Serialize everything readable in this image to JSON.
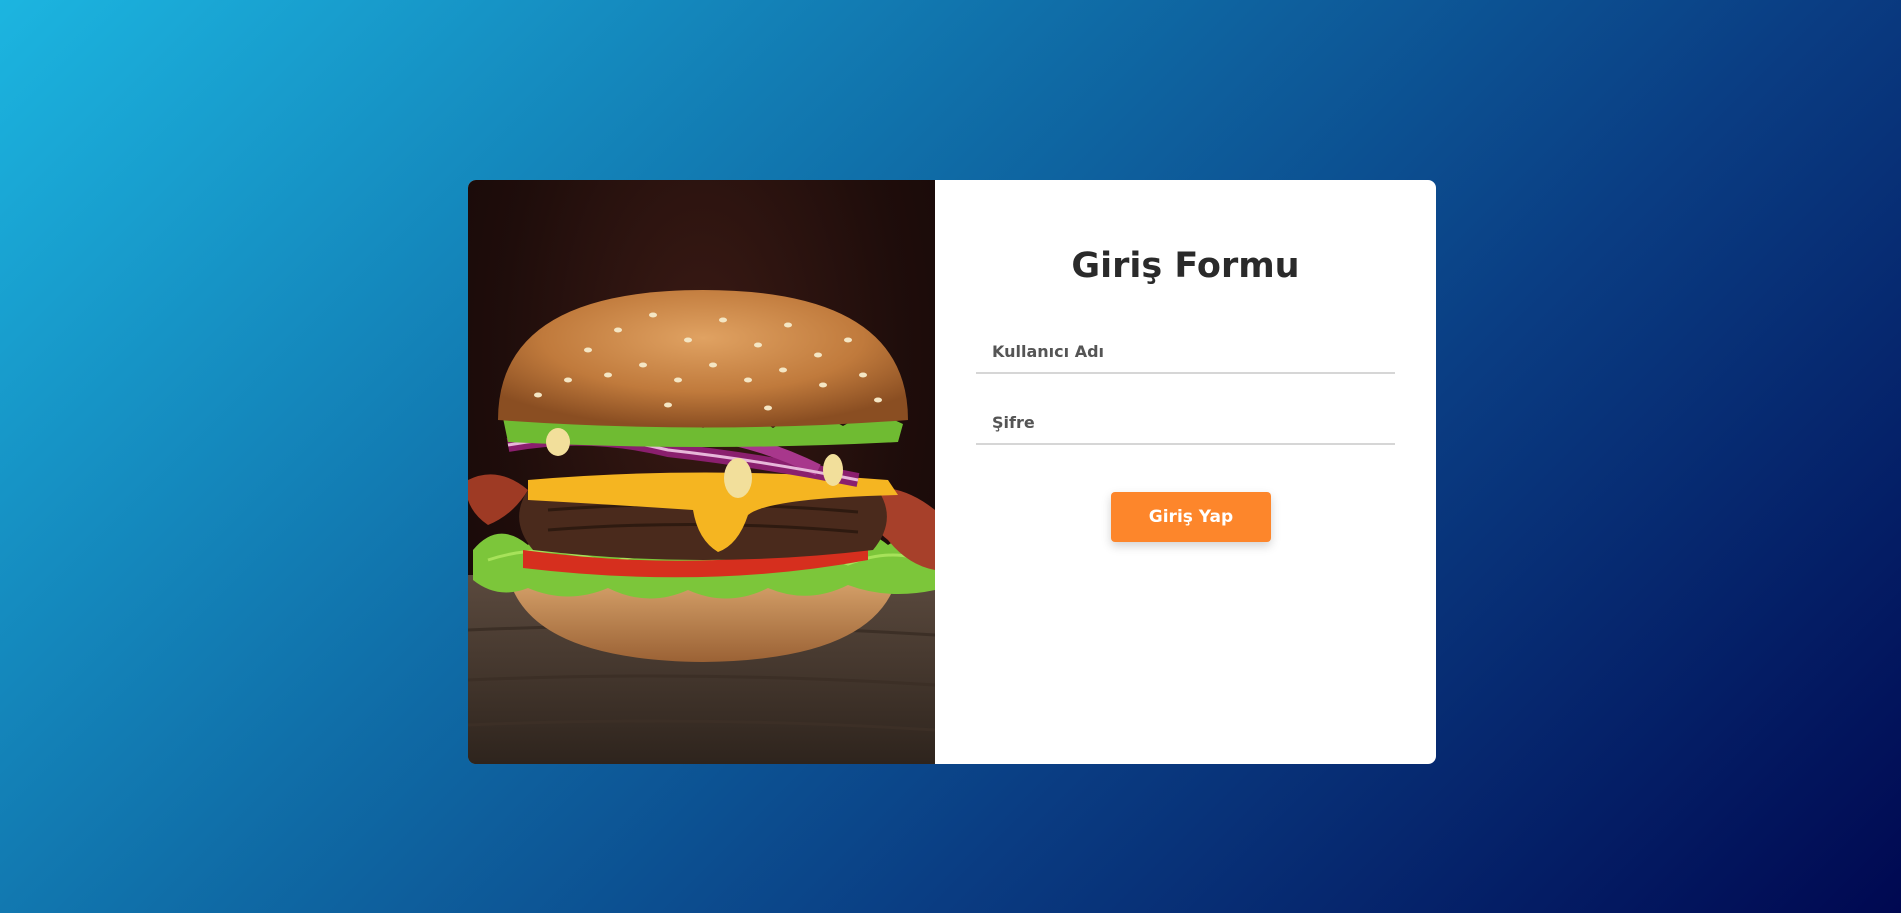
{
  "form": {
    "title": "Giriş Formu",
    "username_placeholder": "Kullanıcı Adı",
    "username_value": "",
    "password_placeholder": "Şifre",
    "password_value": "",
    "submit_label": "Giriş Yap"
  },
  "image": {
    "icon": "burger-photo"
  },
  "colors": {
    "background_start": "#1cb5e0",
    "background_end": "#000851",
    "button": "#fd862b",
    "card": "#ffffff",
    "title": "#2a2a2a"
  }
}
